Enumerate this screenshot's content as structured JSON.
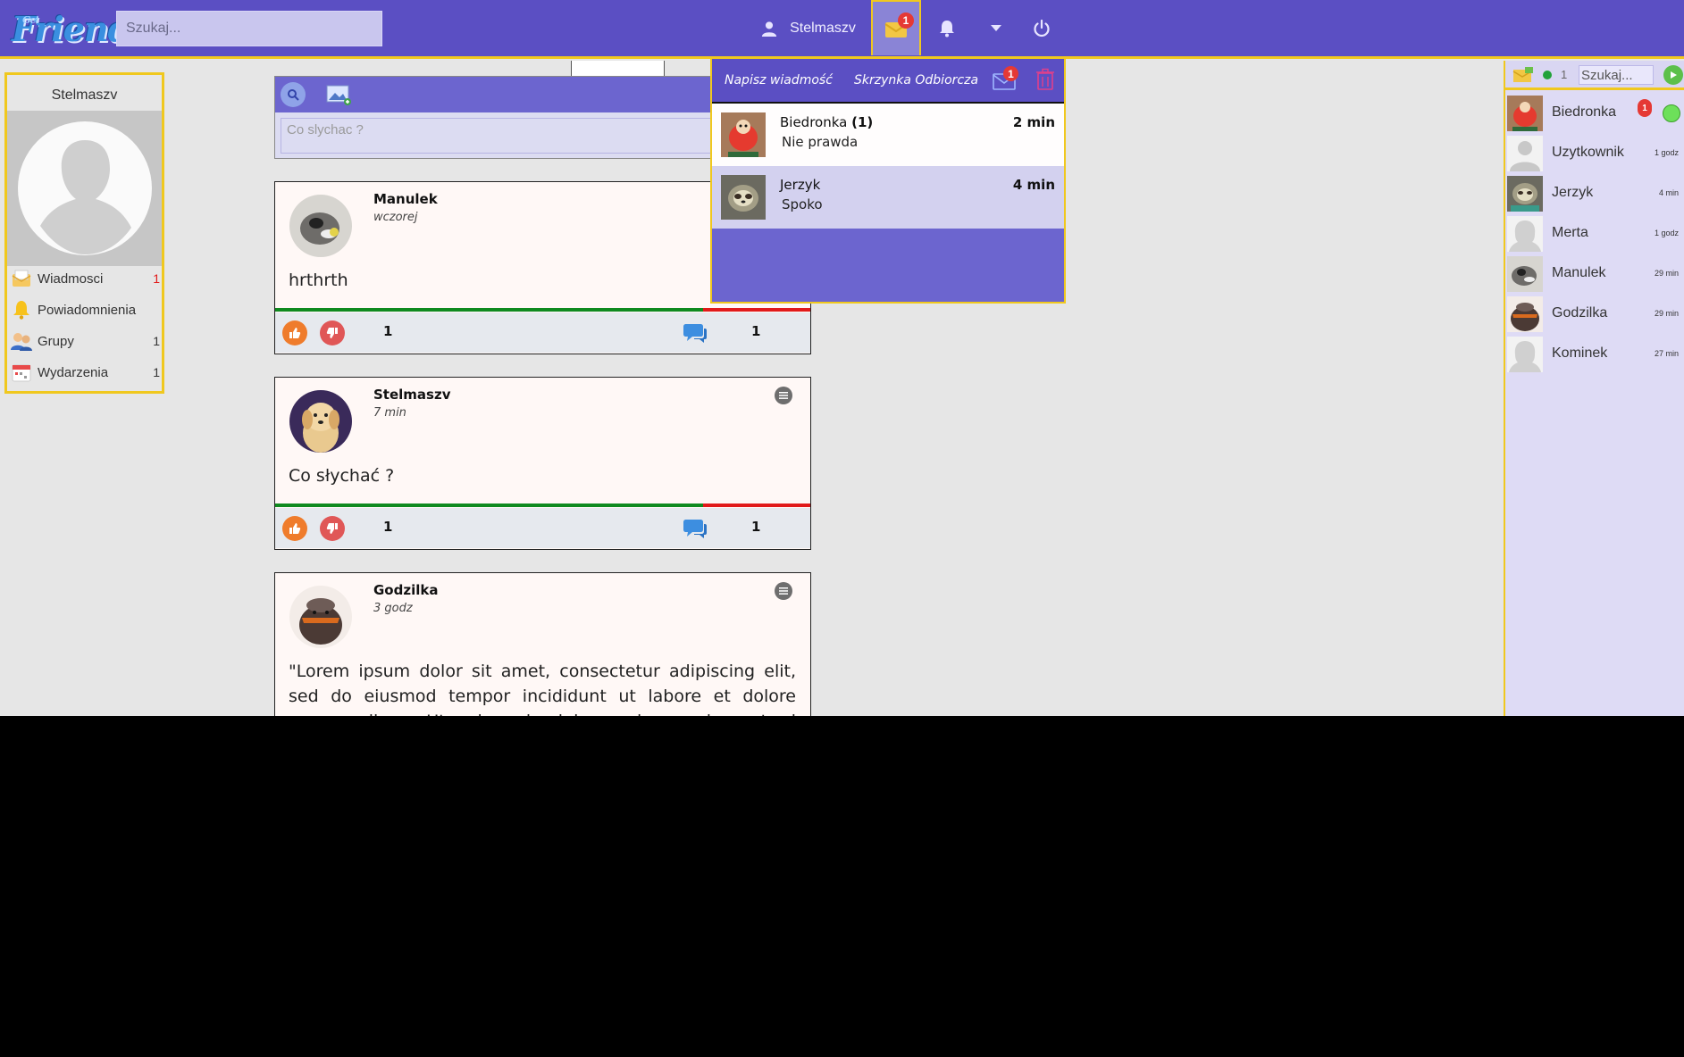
{
  "header": {
    "logo_text": "Friend",
    "logo_tag": "Get",
    "search_placeholder": "Szukaj...",
    "user_name": "Stelmaszv",
    "messages_badge": "1"
  },
  "left_panel": {
    "user_name": "Stelmaszv",
    "items": [
      {
        "label": "Wiadmosci",
        "count": "1",
        "icon": "envelope-icon"
      },
      {
        "label": "Powiadomnienia",
        "count": "",
        "icon": "bell-icon"
      },
      {
        "label": "Grupy",
        "count": "1",
        "icon": "group-icon"
      },
      {
        "label": "Wydarzenia",
        "count": "1",
        "icon": "calendar-icon"
      }
    ]
  },
  "composer": {
    "placeholder": "Co slychac ?"
  },
  "posts": [
    {
      "author": "Manulek",
      "time": "wczorej",
      "text": "hrthrth",
      "likes": "1",
      "comments": "1",
      "green_fraction": 0.8
    },
    {
      "author": "Stelmaszv",
      "time": "7 min",
      "text": "Co słychać ?",
      "likes": "1",
      "comments": "1",
      "green_fraction": 0.8
    },
    {
      "author": "Godzilka",
      "time": "3 godz",
      "text": "\"Lorem ipsum dolor sit amet, consectetur adipiscing elit, sed do eiusmod tempor incididunt ut labore et dolore magna aliqua. Ut enim ad minim veniam, quis nostrud exercitation"
    }
  ],
  "messages_dropdown": {
    "write_label": "Napisz wiadmość",
    "inbox_label": "Skrzynka Odbiorcza",
    "envelope_badge": "1",
    "items": [
      {
        "name": "Biedronka",
        "unread": "(1)",
        "time": "2 min",
        "message": "Nie prawda"
      },
      {
        "name": "Jerzyk",
        "unread": "",
        "time": "4 min",
        "message": "Spoko"
      }
    ]
  },
  "right_panel": {
    "online_count": "1",
    "search_placeholder": "Szukaj...",
    "friends": [
      {
        "name": "Biedronka",
        "time": "",
        "badge": "1",
        "online": true
      },
      {
        "name": "Uzytkownik",
        "time": "1 godz"
      },
      {
        "name": "Jerzyk",
        "time": "4 min"
      },
      {
        "name": "Merta",
        "time": "1 godz"
      },
      {
        "name": "Manulek",
        "time": "29 min"
      },
      {
        "name": "Godzilka",
        "time": "29 min"
      },
      {
        "name": "Kominek",
        "time": "27 min"
      }
    ]
  },
  "colors": {
    "topbar": "#5b4fc3",
    "accent_border": "#f0c81e",
    "like": "#ef7c2c",
    "dislike": "#e05757",
    "bar_green": "#0f8a1f",
    "bar_red": "#e11a1a"
  }
}
